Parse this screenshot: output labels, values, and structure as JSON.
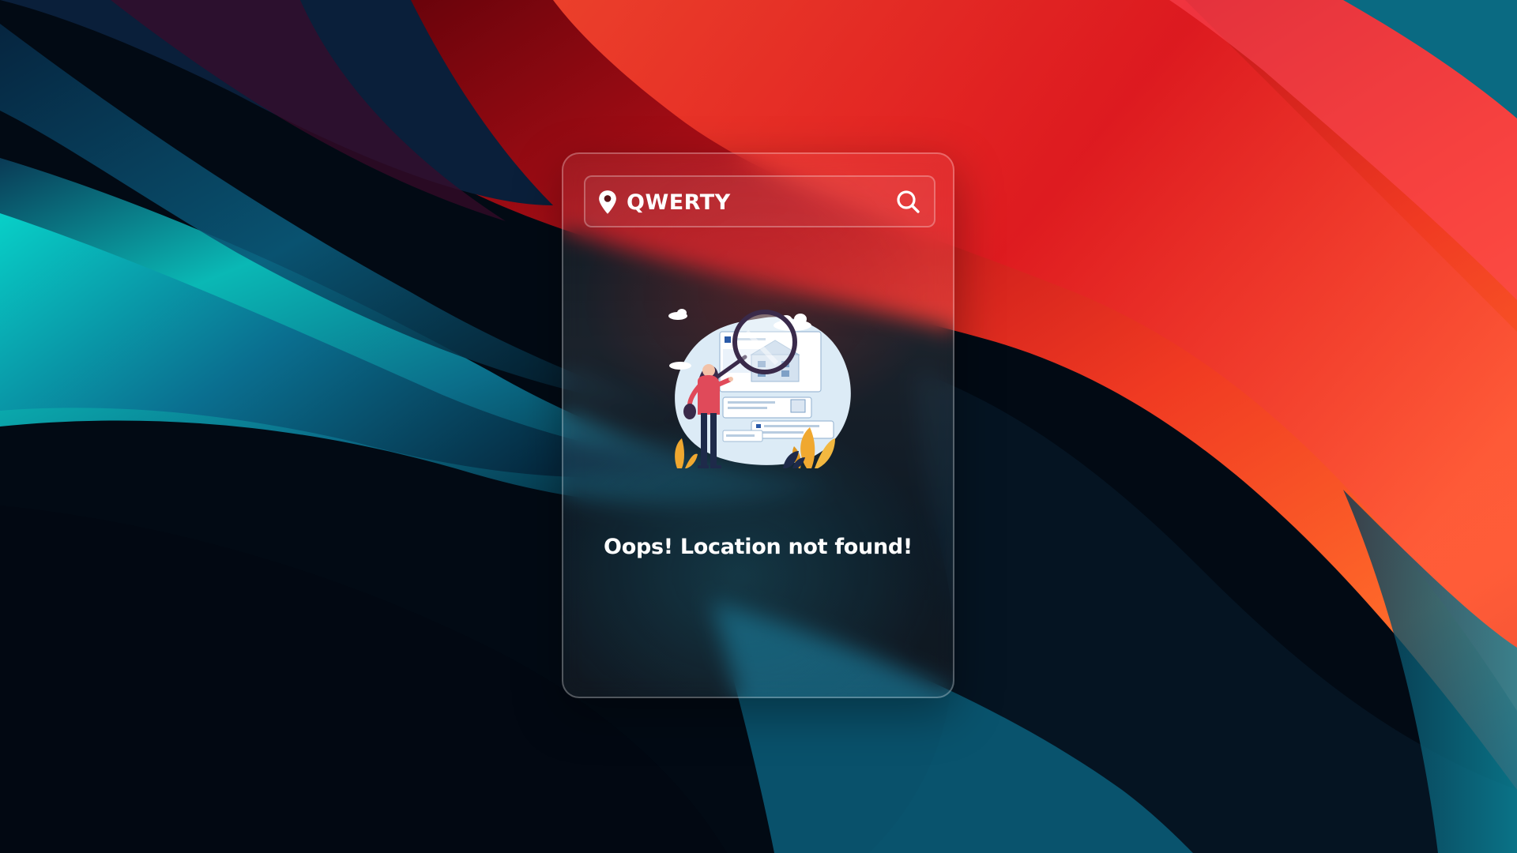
{
  "search": {
    "value": "QWERTY",
    "placeholder": "",
    "location_icon": "map-pin-icon",
    "search_icon": "magnifier-icon"
  },
  "result": {
    "illustration": "person-searching-with-magnifying-glass",
    "message": "Oops! Location not found!"
  },
  "colors": {
    "text": "#ffffff",
    "card_border": "rgba(255,255,255,0.28)",
    "wallpaper_red": "#e8321c",
    "wallpaper_teal": "#0fb3b3",
    "wallpaper_dark": "#020a14"
  }
}
